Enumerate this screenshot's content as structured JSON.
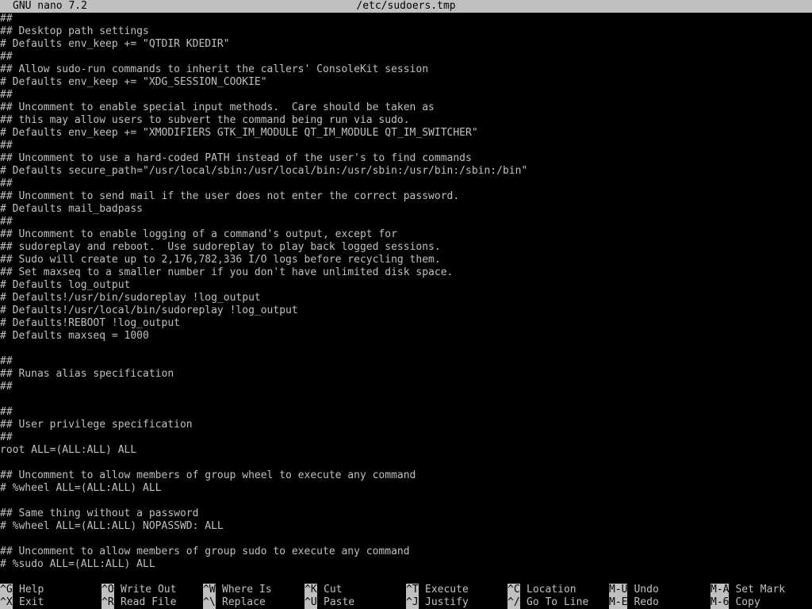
{
  "titlebar": {
    "app": "GNU nano 7.2",
    "filename": "/etc/sudoers.tmp"
  },
  "lines": [
    "##",
    "## Desktop path settings",
    "# Defaults env_keep += \"QTDIR KDEDIR\"",
    "##",
    "## Allow sudo-run commands to inherit the callers' ConsoleKit session",
    "# Defaults env_keep += \"XDG_SESSION_COOKIE\"",
    "##",
    "## Uncomment to enable special input methods.  Care should be taken as",
    "## this may allow users to subvert the command being run via sudo.",
    "# Defaults env_keep += \"XMODIFIERS GTK_IM_MODULE QT_IM_MODULE QT_IM_SWITCHER\"",
    "##",
    "## Uncomment to use a hard-coded PATH instead of the user's to find commands",
    "# Defaults secure_path=\"/usr/local/sbin:/usr/local/bin:/usr/sbin:/usr/bin:/sbin:/bin\"",
    "##",
    "## Uncomment to send mail if the user does not enter the correct password.",
    "# Defaults mail_badpass",
    "##",
    "## Uncomment to enable logging of a command's output, except for",
    "## sudoreplay and reboot.  Use sudoreplay to play back logged sessions.",
    "## Sudo will create up to 2,176,782,336 I/O logs before recycling them.",
    "## Set maxseq to a smaller number if you don't have unlimited disk space.",
    "# Defaults log_output",
    "# Defaults!/usr/bin/sudoreplay !log_output",
    "# Defaults!/usr/local/bin/sudoreplay !log_output",
    "# Defaults!REBOOT !log_output",
    "# Defaults maxseq = 1000",
    "",
    "##",
    "## Runas alias specification",
    "##",
    "",
    "##",
    "## User privilege specification",
    "##",
    "root ALL=(ALL:ALL) ALL",
    "",
    "## Uncomment to allow members of group wheel to execute any command",
    "# %wheel ALL=(ALL:ALL) ALL",
    "",
    "## Same thing without a password",
    "# %wheel ALL=(ALL:ALL) NOPASSWD: ALL",
    "",
    "## Uncomment to allow members of group sudo to execute any command",
    "# %sudo ALL=(ALL:ALL) ALL"
  ],
  "shortcuts": [
    {
      "key": "^G",
      "label": "Help",
      "icon": "help-icon"
    },
    {
      "key": "^X",
      "label": "Exit",
      "icon": "exit-icon"
    },
    {
      "key": "^O",
      "label": "Write Out",
      "icon": "save-icon"
    },
    {
      "key": "^R",
      "label": "Read File",
      "icon": "open-file-icon"
    },
    {
      "key": "^W",
      "label": "Where Is",
      "icon": "search-icon"
    },
    {
      "key": "^\\",
      "label": "Replace",
      "icon": "replace-icon"
    },
    {
      "key": "^K",
      "label": "Cut",
      "icon": "cut-icon"
    },
    {
      "key": "^U",
      "label": "Paste",
      "icon": "paste-icon"
    },
    {
      "key": "^T",
      "label": "Execute",
      "icon": "execute-icon"
    },
    {
      "key": "^J",
      "label": "Justify",
      "icon": "justify-icon"
    },
    {
      "key": "^C",
      "label": "Location",
      "icon": "location-icon"
    },
    {
      "key": "^/",
      "label": "Go To Line",
      "icon": "goto-line-icon"
    },
    {
      "key": "M-U",
      "label": "Undo",
      "icon": "undo-icon"
    },
    {
      "key": "M-E",
      "label": "Redo",
      "icon": "redo-icon"
    },
    {
      "key": "M-A",
      "label": "Set Mark",
      "icon": "mark-icon"
    },
    {
      "key": "M-6",
      "label": "Copy",
      "icon": "copy-icon"
    }
  ],
  "colors": {
    "background": "#000000",
    "text": "#c0c0c0",
    "inverse_bg": "#c0c0c0",
    "inverse_fg": "#000000"
  }
}
